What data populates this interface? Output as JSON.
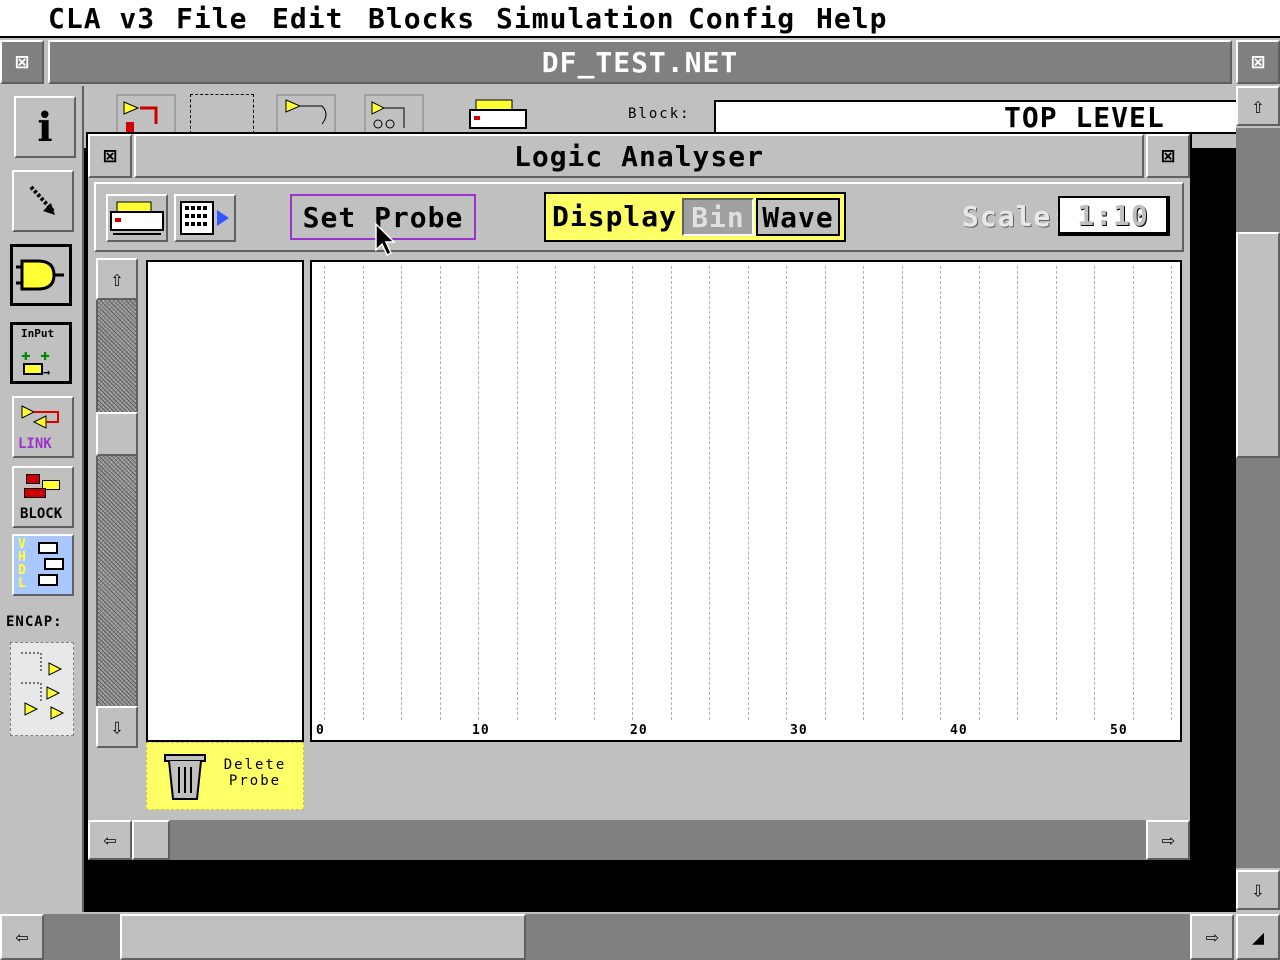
{
  "menubar": {
    "app": "CLA v3",
    "items": [
      "File",
      "Edit",
      "Blocks",
      "Simulation",
      "Config",
      "Help"
    ]
  },
  "main_window": {
    "title": "DF_TEST.NET",
    "block_label": "Block:",
    "block_value": "TOP LEVEL"
  },
  "palette": {
    "input_label": "InPut",
    "link_label": "LINK",
    "block_label": "BLOCK",
    "vhdl_label": "VHDL",
    "encap_label": "ENCAP:"
  },
  "logic_analyser": {
    "title": "Logic Analyser",
    "set_probe": "Set Probe",
    "display_label": "Display:",
    "display_options": [
      "Bin",
      "Wave"
    ],
    "display_selected": "Wave",
    "scale_label": "Scale:",
    "scale_value": "1:10",
    "delete_probe": [
      "Delete",
      "Probe"
    ],
    "axis_ticks": [
      "0",
      "10",
      "20",
      "30",
      "40",
      "50"
    ]
  },
  "colors": {
    "yellow": "#ffff66",
    "window_gray": "#c0c0c0",
    "highlight_purple": "#9933cc"
  }
}
